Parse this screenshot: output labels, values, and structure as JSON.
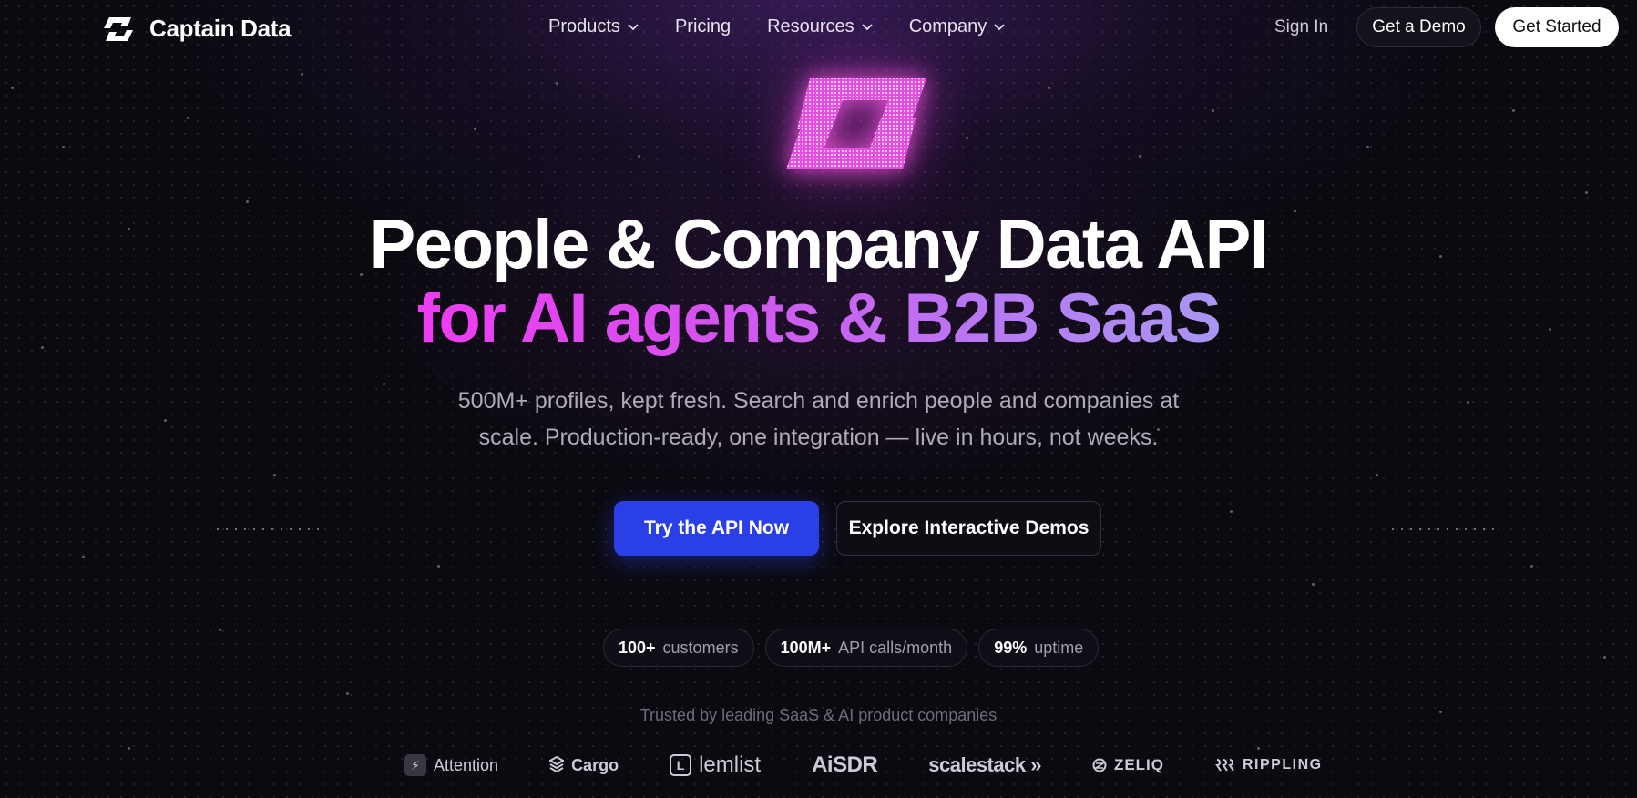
{
  "nav": {
    "brand": "Captain Data",
    "links": [
      {
        "label": "Products",
        "dropdown": true
      },
      {
        "label": "Pricing",
        "dropdown": false
      },
      {
        "label": "Resources",
        "dropdown": true
      },
      {
        "label": "Company",
        "dropdown": true
      }
    ],
    "sign_in": "Sign In",
    "demo": "Get a Demo",
    "start": "Get Started"
  },
  "hero": {
    "title_line1": "People & Company Data API",
    "title_line2": "for AI agents & B2B SaaS",
    "subtitle_line1": "500M+ profiles, kept fresh. Search and enrich people and companies at",
    "subtitle_line2": "scale. Production-ready, one integration — live in hours, not weeks.",
    "cta_primary": "Try the API Now",
    "cta_secondary": "Explore Interactive Demos"
  },
  "stats": [
    {
      "value": "100+",
      "label": "customers"
    },
    {
      "value": "100M+",
      "label": "API calls/month"
    },
    {
      "value": "99%",
      "label": "uptime"
    }
  ],
  "trusted": "Trusted by leading SaaS & AI product companies",
  "brands": [
    {
      "name": "Attention",
      "icon": "bolt-icon"
    },
    {
      "name": "Cargo",
      "icon": "cargo-icon"
    },
    {
      "name": "lemlist",
      "icon": "lemlist-icon"
    },
    {
      "name": "AiSDR",
      "icon": ""
    },
    {
      "name": "scalestack »",
      "icon": ""
    },
    {
      "name": "ZELIQ",
      "icon": "zeliq-icon"
    },
    {
      "name": "RIPPLING",
      "icon": "rippling-icon"
    }
  ],
  "colors": {
    "background": "#0b0a10",
    "primary_button": "#2a40e6",
    "gradient_start": "#ee3cf2",
    "gradient_end": "#a996f2",
    "glow_logo": "#ff5ae6"
  }
}
